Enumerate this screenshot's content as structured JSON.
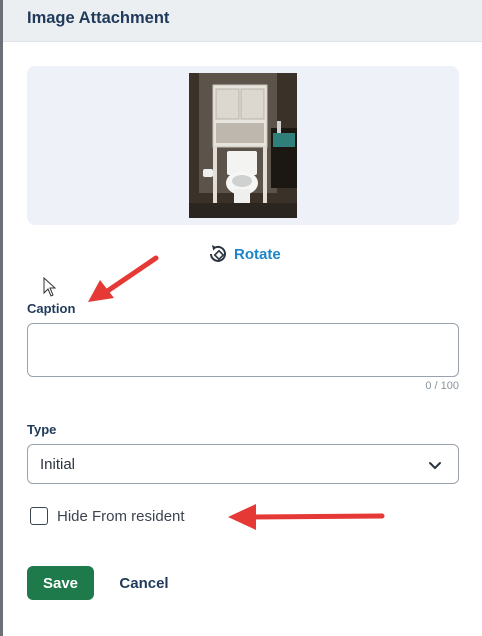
{
  "header": {
    "title": "Image Attachment"
  },
  "preview": {
    "image_name": "bathroom-photo"
  },
  "rotate": {
    "label": "Rotate",
    "icon": "rotate-icon"
  },
  "caption": {
    "label": "Caption",
    "value": "",
    "counter": "0 / 100"
  },
  "type": {
    "label": "Type",
    "selected": "Initial",
    "icon": "chevron-down-icon"
  },
  "hide_from_resident": {
    "label": "Hide From resident",
    "checked": false
  },
  "actions": {
    "save_label": "Save",
    "cancel_label": "Cancel"
  },
  "colors": {
    "primary_button": "#1e7a4a",
    "link": "#1e86c8",
    "heading": "#1f3a5a",
    "annotation_arrow": "#e53935"
  }
}
